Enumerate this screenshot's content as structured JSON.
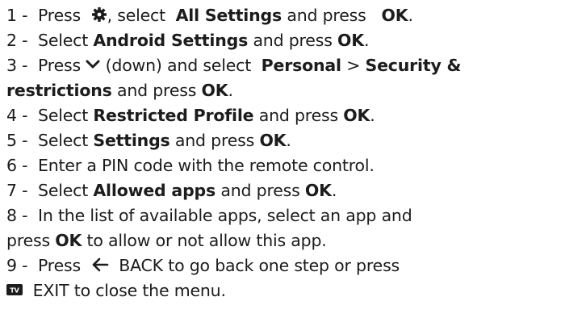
{
  "steps": [
    {
      "num": "1 -",
      "parts": {
        "a": "Press",
        "b": ", select",
        "c": "All Settings",
        "d": "and press",
        "e": "OK",
        "f": "."
      }
    },
    {
      "num": "2 -",
      "parts": {
        "a": "Select",
        "b": "Android Settings",
        "c": "and press",
        "d": "OK",
        "e": "."
      }
    },
    {
      "num": "3 -",
      "parts": {
        "a": "Press",
        "b": "(down) and select",
        "c": "Personal",
        "d": ">",
        "e": "Security &",
        "f": "restrictions",
        "g": "and press",
        "h": "OK",
        "i": "."
      }
    },
    {
      "num": "4 -",
      "parts": {
        "a": "Select",
        "b": "Restricted Profile",
        "c": "and press",
        "d": "OK",
        "e": "."
      }
    },
    {
      "num": "5 -",
      "parts": {
        "a": "Select",
        "b": "Settings",
        "c": "and press",
        "d": "OK",
        "e": "."
      }
    },
    {
      "num": "6 -",
      "parts": {
        "a": "Enter a PIN code with the remote control."
      }
    },
    {
      "num": "7 -",
      "parts": {
        "a": "Select",
        "b": "Allowed apps",
        "c": "and press",
        "d": "OK",
        "e": "."
      }
    },
    {
      "num": "8 -",
      "parts": {
        "a": "In the list of available apps, select an app and",
        "b": "press",
        "c": "OK",
        "d": "to allow or not allow this app."
      }
    },
    {
      "num": "9 -",
      "parts": {
        "a": "Press",
        "b": "BACK",
        "c": "to go back one step or press",
        "d": "EXIT",
        "e": "to close the menu."
      }
    }
  ],
  "icons": {
    "settings": "gear-icon",
    "down": "chevron-down-icon",
    "back": "back-arrow-icon",
    "tv": "tv-icon"
  }
}
